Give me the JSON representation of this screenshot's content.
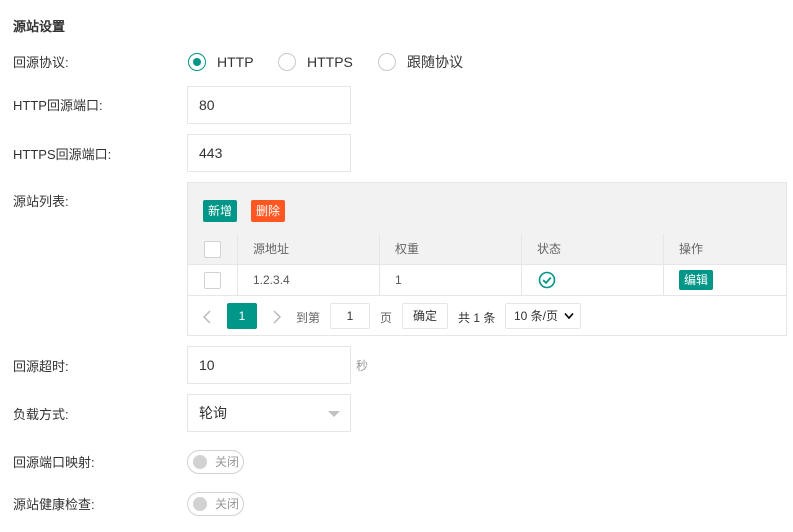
{
  "section_title": "源站设置",
  "labels": {
    "protocol": "回源协议:",
    "http_port": "HTTP回源端口:",
    "https_port": "HTTPS回源端口:",
    "origin_list": "源站列表:",
    "timeout": "回源超时:",
    "load_mode": "负载方式:",
    "port_mapping": "回源端口映射:",
    "health_check": "源站健康检查:"
  },
  "protocol_options": [
    {
      "label": "HTTP",
      "checked": true
    },
    {
      "label": "HTTPS",
      "checked": false
    },
    {
      "label": "跟随协议",
      "checked": false
    }
  ],
  "http_port_value": "80",
  "https_port_value": "443",
  "origin_table": {
    "add_label": "新增",
    "delete_label": "删除",
    "columns": [
      "源地址",
      "权重",
      "状态",
      "操作"
    ],
    "rows": [
      {
        "address": "1.2.3.4",
        "weight": "1",
        "status": "ok",
        "action": "编辑"
      }
    ],
    "pager": {
      "current_page": "1",
      "goto_label": "到第",
      "goto_value": "1",
      "page_unit": "页",
      "confirm_label": "确定",
      "total_text": "共 1 条",
      "page_size": "10 条/页"
    }
  },
  "timeout_value": "10",
  "timeout_unit": "秒",
  "load_mode_value": "轮询",
  "port_mapping_switch": "关闭",
  "health_check_switch": "关闭",
  "colors": {
    "accent": "#009688",
    "danger": "#ff5722"
  }
}
